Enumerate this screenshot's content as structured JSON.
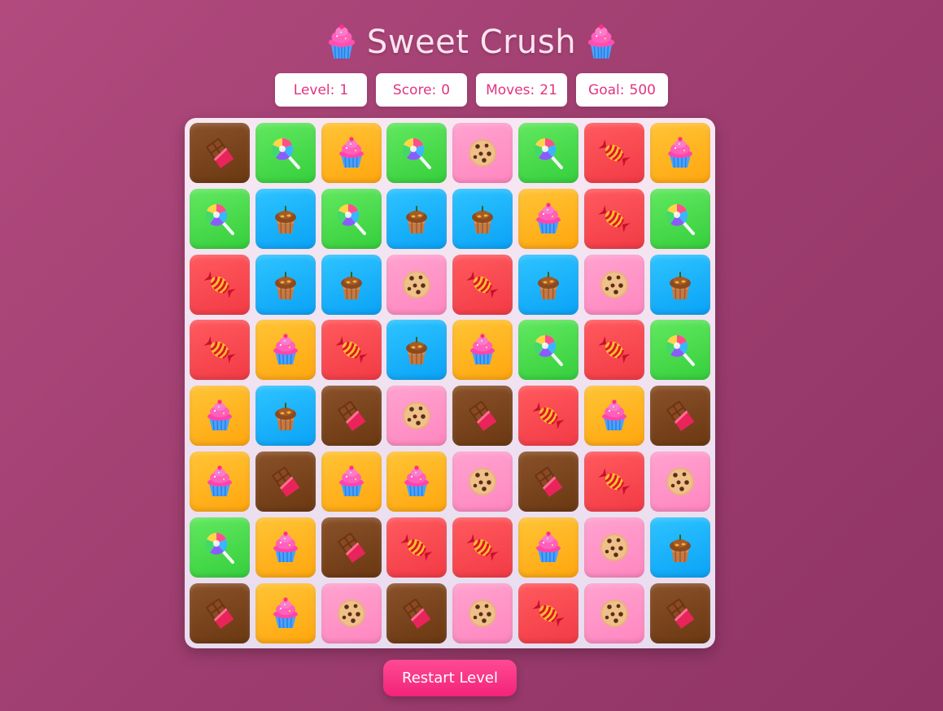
{
  "game": {
    "title": "Sweet Crush",
    "title_icon": "cupcake-icon"
  },
  "stats": {
    "level_label": "Level:",
    "level_value": "1",
    "score_label": "Score:",
    "score_value": "0",
    "moves_label": "Moves:",
    "moves_value": "21",
    "goal_label": "Goal:",
    "goal_value": "500"
  },
  "board": {
    "rows": 8,
    "cols": 8,
    "tile_types": {
      "chocolate": {
        "icon": "chocolate-bar-icon",
        "color": "#7a4420"
      },
      "lollipop": {
        "icon": "lollipop-icon",
        "color": "#4bdc4e"
      },
      "cupcake": {
        "icon": "cupcake-icon",
        "color": "#ffb31e"
      },
      "cookie": {
        "icon": "cookie-icon",
        "color": "#ff93c7"
      },
      "candy": {
        "icon": "wrapped-candy-icon",
        "color": "#f94a52"
      },
      "muffin": {
        "icon": "muffin-icon",
        "color": "#1cb3fb"
      }
    },
    "grid": [
      [
        "chocolate",
        "lollipop",
        "cupcake",
        "lollipop",
        "cookie",
        "lollipop",
        "candy",
        "cupcake"
      ],
      [
        "lollipop",
        "muffin",
        "lollipop",
        "muffin",
        "muffin",
        "cupcake",
        "candy",
        "lollipop"
      ],
      [
        "candy",
        "muffin",
        "muffin",
        "cookie",
        "candy",
        "muffin",
        "cookie",
        "muffin"
      ],
      [
        "candy",
        "cupcake",
        "candy",
        "muffin",
        "cupcake",
        "lollipop",
        "candy",
        "lollipop"
      ],
      [
        "cupcake",
        "muffin",
        "chocolate",
        "cookie",
        "chocolate",
        "candy",
        "cupcake",
        "chocolate"
      ],
      [
        "cupcake",
        "chocolate",
        "cupcake",
        "cupcake",
        "cookie",
        "chocolate",
        "candy",
        "cookie"
      ],
      [
        "lollipop",
        "cupcake",
        "chocolate",
        "candy",
        "candy",
        "cupcake",
        "cookie",
        "muffin"
      ],
      [
        "chocolate",
        "cupcake",
        "cookie",
        "chocolate",
        "cookie",
        "candy",
        "cookie",
        "chocolate"
      ]
    ]
  },
  "actions": {
    "restart_label": "Restart Level"
  }
}
